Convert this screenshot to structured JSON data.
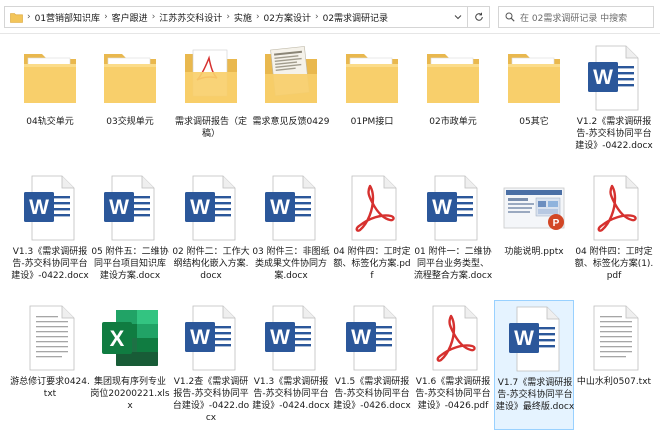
{
  "breadcrumbs": [
    "01营销部知识库",
    "客户跟进",
    "江苏苏交科设计",
    "实施",
    "02方案设计",
    "02需求调研记录"
  ],
  "search": {
    "placeholder": "在 02需求调研记录 中搜索"
  },
  "icons": {
    "search": "search-icon",
    "refresh": "refresh-icon",
    "dropdown": "chevron-down-icon",
    "folder": "folder-icon"
  },
  "colors": {
    "word": "#2b579a",
    "excel": "#1d7044",
    "pdf": "#d6312f",
    "folder": "#f6c968",
    "selection": "#e5f3ff"
  },
  "files": [
    {
      "name": "04轨交单元",
      "type": "folder"
    },
    {
      "name": "03交规单元",
      "type": "folder"
    },
    {
      "name": "需求调研报告（定稿）",
      "type": "folder-pdf"
    },
    {
      "name": "需求意见反馈0429",
      "type": "folder-doc"
    },
    {
      "name": "01PM接口",
      "type": "folder"
    },
    {
      "name": "02市政单元",
      "type": "folder"
    },
    {
      "name": "05其它",
      "type": "folder"
    },
    {
      "name": "V1.2《需求调研报告-苏交科协同平台建设》-0422.docx",
      "type": "word"
    },
    {
      "name": "V1.3《需求调研报告-苏交科协同平台建设》-0422.docx",
      "type": "word"
    },
    {
      "name": "05 附件五：二维协同平台项目知识库建设方案.docx",
      "type": "word"
    },
    {
      "name": "02 附件二：工作大纲结构化嵌入方案.docx",
      "type": "word"
    },
    {
      "name": "03 附件三：非图纸类成果文件协同方案.docx",
      "type": "word"
    },
    {
      "name": "04 附件四：工时定额、标签化方案.pdf",
      "type": "pdf"
    },
    {
      "name": "01 附件一：二维协同平台业务类型、流程整合方案.docx",
      "type": "word"
    },
    {
      "name": "功能说明.pptx",
      "type": "pptx"
    },
    {
      "name": "04 附件四：工时定额、标签化方案(1).pdf",
      "type": "pdf"
    },
    {
      "name": "游总修订要求0424.txt",
      "type": "txt"
    },
    {
      "name": "集团现有序列专业岗位20200221.xlsx",
      "type": "excel"
    },
    {
      "name": "V1.2查《需求调研报告-苏交科协同平台建设》-0422.docx",
      "type": "word"
    },
    {
      "name": "V1.3《需求调研报告-苏交科协同平台建设》-0424.docx",
      "type": "word"
    },
    {
      "name": "V1.5《需求调研报告-苏交科协同平台建设》-0426.docx",
      "type": "word"
    },
    {
      "name": "V1.6《需求调研报告-苏交科协同平台建设》-0426.pdf",
      "type": "pdf"
    },
    {
      "name": "V1.7《需求调研报告-苏交科协同平台建设》最终版.docx",
      "type": "word",
      "selected": true
    },
    {
      "name": "中山水利0507.txt",
      "type": "txt"
    }
  ]
}
